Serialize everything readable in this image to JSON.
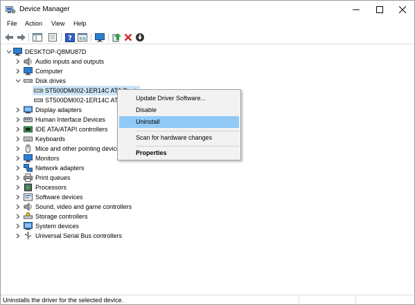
{
  "window": {
    "title": "Device Manager"
  },
  "menu": [
    "File",
    "Action",
    "View",
    "Help"
  ],
  "toolbar": {
    "buttons": [
      "back-icon",
      "forward-icon",
      "show-hide-console-tree-icon",
      "properties-icon",
      "help-icon",
      "view-icon",
      "monitor-icon",
      "update-driver-icon",
      "uninstall-icon",
      "scan-hardware-icon"
    ]
  },
  "tree": {
    "root": "DESKTOP-Q8MU87D",
    "disk_devices": [
      "ST500DM002-1ER14C ATA Device",
      "ST500DM002-1ER14C ATA Device"
    ],
    "categories": [
      "Audio inputs and outputs",
      "Computer",
      "Disk drives",
      "Display adapters",
      "Human Interface Devices",
      "IDE ATA/ATAPI controllers",
      "Keyboards",
      "Mice and other pointing devices",
      "Monitors",
      "Network adapters",
      "Print queues",
      "Processors",
      "Software devices",
      "Sound, video and game controllers",
      "Storage controllers",
      "System devices",
      "Universal Serial Bus controllers"
    ]
  },
  "context_menu": {
    "items": [
      "Update Driver Software...",
      "Disable",
      "Uninstall",
      "Scan for hardware changes",
      "Properties"
    ],
    "highlighted": "Uninstall"
  },
  "status": {
    "text": "Uninstalls the driver for the selected device."
  },
  "colors": {
    "selection": "#cce4f7",
    "menu_highlight": "#91c9f7",
    "close_red": "#d62828",
    "update_green": "#2e9e3f"
  }
}
